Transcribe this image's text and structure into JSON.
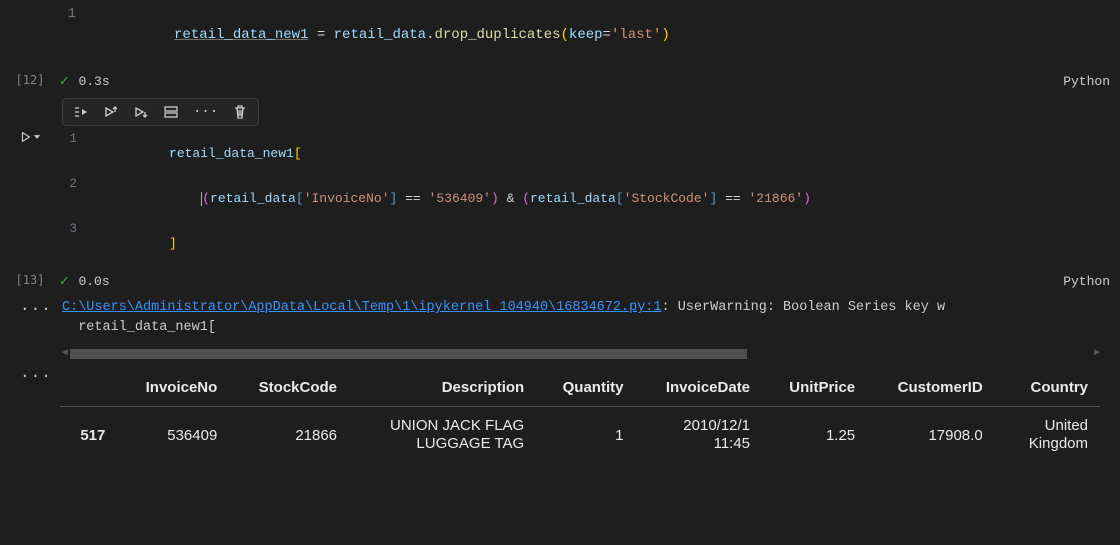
{
  "cells": [
    {
      "exec_label": "[12]",
      "timing": "0.3s",
      "language": "Python",
      "code": {
        "line1_num": "1",
        "l1_lhs": "retail_data_new1",
        "l1_eq": " = ",
        "l1_obj": "retail_data",
        "l1_dot": ".",
        "l1_fn": "drop_duplicates",
        "l1_open": "(",
        "l1_kwarg": "keep",
        "l1_eq2": "=",
        "l1_str": "'last'",
        "l1_close": ")"
      }
    },
    {
      "exec_label": "[13]",
      "timing": "0.0s",
      "language": "Python",
      "code": {
        "l1_num": "1",
        "l1_var": "retail_data_new1",
        "l1_open": "[",
        "l2_num": "2",
        "l2_indent": "    ",
        "l2_open1": "(",
        "l2_obj1": "retail_data",
        "l2_br1o": "[",
        "l2_str1": "'InvoiceNo'",
        "l2_br1c": "]",
        "l2_eq1": " == ",
        "l2_val1": "'536409'",
        "l2_close1": ")",
        "l2_amp": " & ",
        "l2_open2": "(",
        "l2_obj2": "retail_data",
        "l2_br2o": "[",
        "l2_str2": "'StockCode'",
        "l2_br2c": "]",
        "l2_eq2": " == ",
        "l2_val2": "'21866'",
        "l2_close2": ")",
        "l3_num": "3",
        "l3_close": "]"
      },
      "output": {
        "warn_path": "C:\\Users\\Administrator\\AppData\\Local\\Temp\\1\\ipykernel_104940\\16834672.py:1",
        "warn_rest": ": UserWarning: Boolean Series key w",
        "warn_line2": "  retail_data_new1["
      },
      "table": {
        "idx_header": "",
        "cols": [
          "InvoiceNo",
          "StockCode",
          "Description",
          "Quantity",
          "InvoiceDate",
          "UnitPrice",
          "CustomerID",
          "Country"
        ],
        "row": {
          "idx": "517",
          "InvoiceNo": "536409",
          "StockCode": "21866",
          "Description": "UNION JACK FLAG LUGGAGE TAG",
          "Quantity": "1",
          "InvoiceDate": "2010/12/1 11:45",
          "UnitPrice": "1.25",
          "CustomerID": "17908.0",
          "Country": "United Kingdom"
        }
      }
    }
  ],
  "icons": {
    "ellipsis": "···"
  }
}
